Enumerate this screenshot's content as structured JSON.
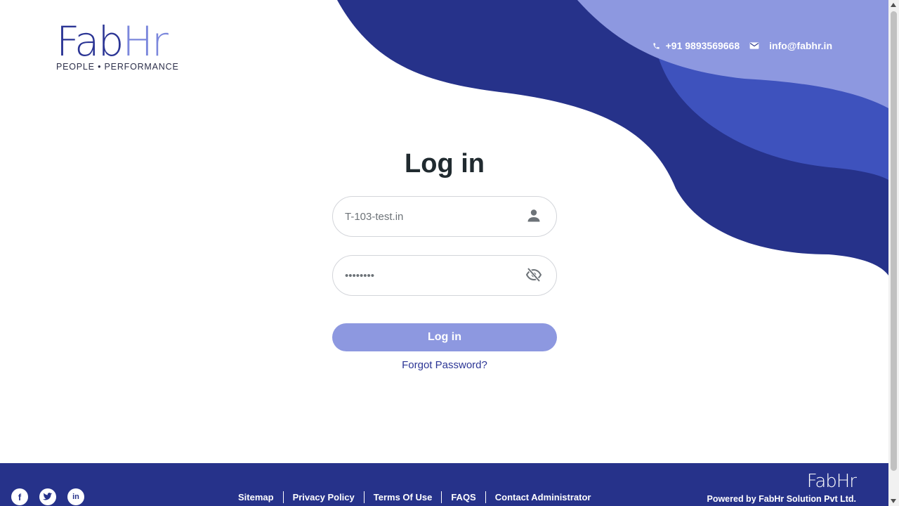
{
  "brand": {
    "logo_text_a": "Fab",
    "logo_text_b": "Hr",
    "tagline": "PEOPLE • PERFORMANCE",
    "primary_color": "#26328a",
    "accent_color": "#8d98e0"
  },
  "contact": {
    "phone_icon": "phone-icon",
    "phone": "+91 9893569668",
    "email_icon": "envelope-icon",
    "email": "info@fabhr.in"
  },
  "login": {
    "title": "Log in",
    "username": {
      "value": "T-103-test.in",
      "icon": "user-icon"
    },
    "password": {
      "value": "••••••••",
      "icon": "eye-slash-icon"
    },
    "submit_label": "Log in",
    "forgot_label": "Forgot Password?"
  },
  "footer": {
    "social": [
      {
        "name": "facebook-icon",
        "glyph": "f"
      },
      {
        "name": "twitter-icon",
        "glyph": "t"
      },
      {
        "name": "linkedin-icon",
        "glyph": "in"
      }
    ],
    "links": [
      "Sitemap",
      "Privacy Policy",
      "Terms Of Use",
      "FAQS",
      "Contact Administrator"
    ],
    "logo_text": "FabHr",
    "powered_by": "Powered by FabHr Solution Pvt Ltd."
  }
}
